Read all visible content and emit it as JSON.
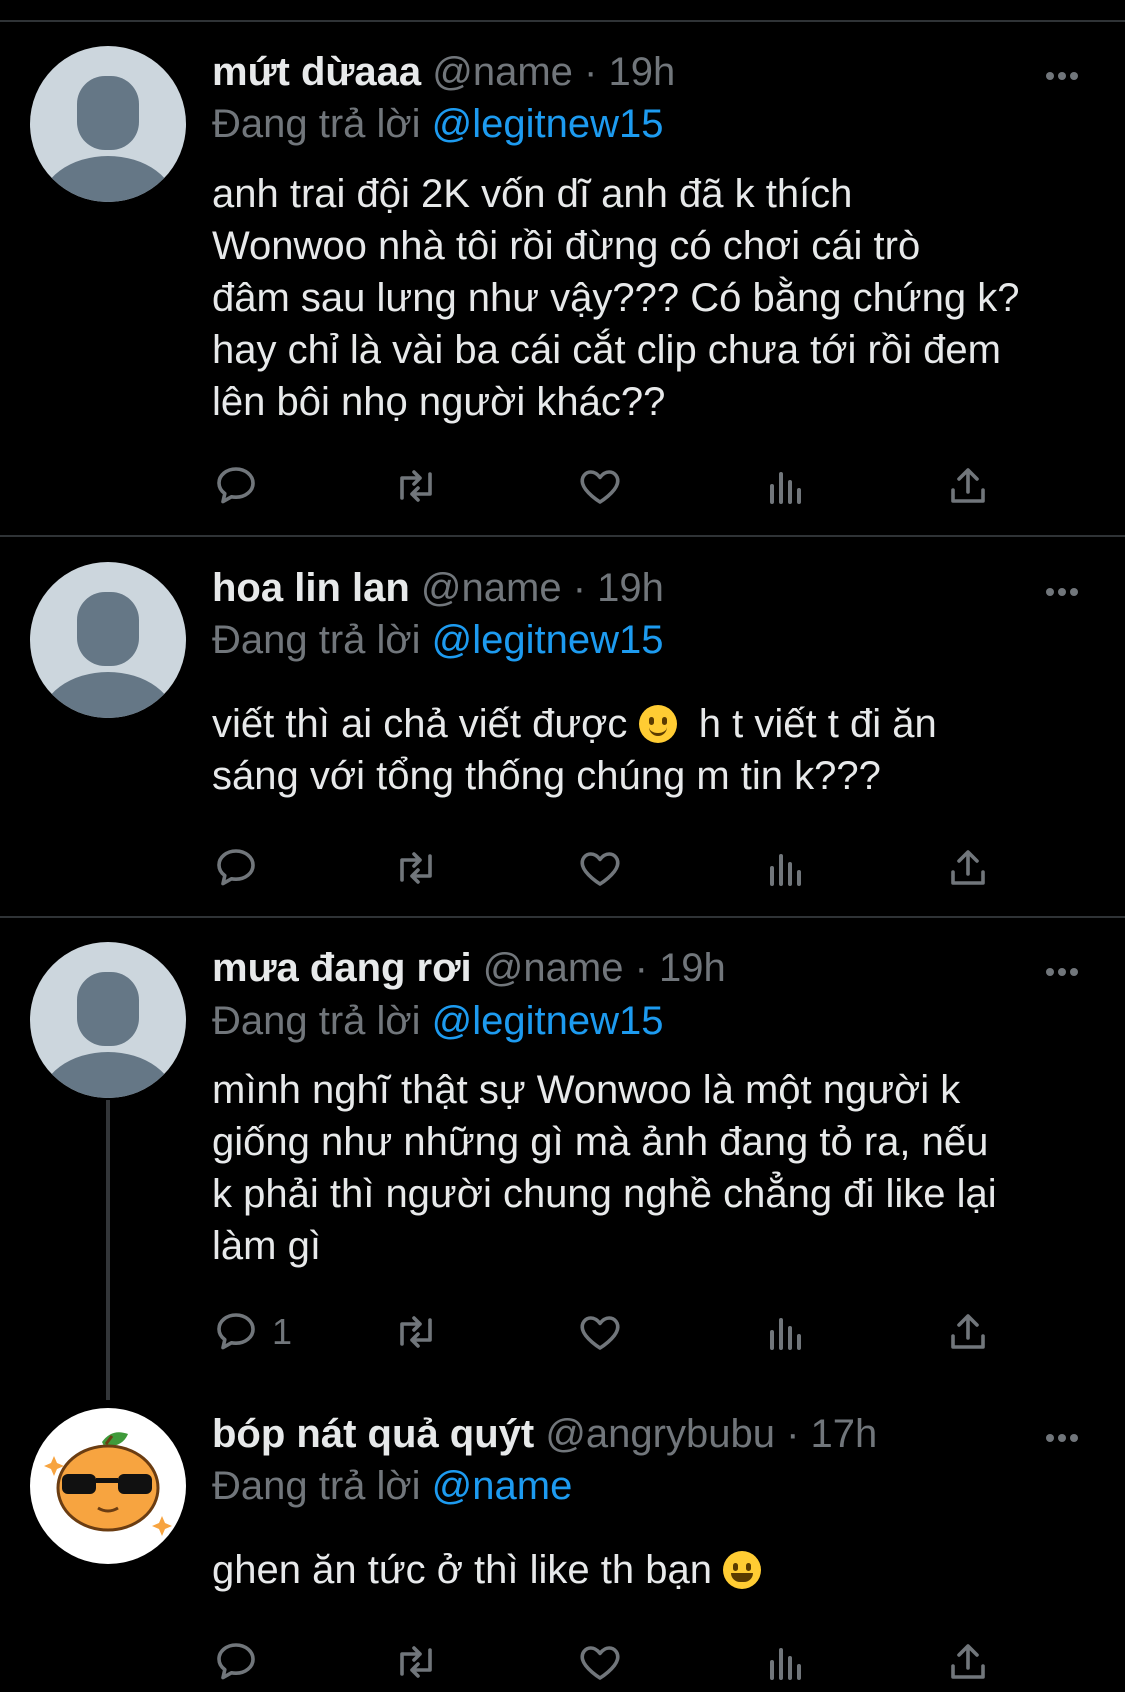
{
  "tweets": [
    {
      "name": "mứt dừaaa",
      "handle": "@name",
      "dot": "·",
      "time": "19h",
      "reply_prefix": "Đang trả lời",
      "reply_to": "@legitnew15",
      "lines": [
        "anh trai đội 2K vốn dĩ anh đã k thích",
        "Wonwoo nhà tôi rồi đừng có chơi cái trò",
        "đâm sau lưng như vậy??? Có bằng chứng k?",
        "hay chỉ là vài ba cái cắt clip chưa tới rồi đem",
        "lên bôi nhọ người khác??"
      ],
      "reply_count": ""
    },
    {
      "name": "hoa lin lan",
      "handle": "@name",
      "dot": "·",
      "time": "19h",
      "reply_prefix": "Đang trả lời",
      "reply_to": "@legitnew15",
      "line1_a": "viết thì ai chả viết được",
      "line1_b": "h t viết t đi ăn",
      "line2": "sáng với tổng thống chúng m tin k???",
      "reply_count": ""
    },
    {
      "name": "mưa đang rơi",
      "handle": "@name",
      "dot": "·",
      "time": "19h",
      "reply_prefix": "Đang trả lời",
      "reply_to": "@legitnew15",
      "lines": [
        "mình nghĩ thật sự Wonwoo là một người k",
        "giống như những gì mà ảnh đang tỏ ra, nếu",
        "k phải thì người chung nghề chẳng đi like lại",
        "làm gì"
      ],
      "reply_count": "1"
    },
    {
      "name": "bóp nát quả quýt",
      "handle": "@angrybubu",
      "dot": "·",
      "time": "17h",
      "reply_prefix": "Đang trả lời",
      "reply_to": "@name",
      "line1": "ghen ăn tức ở thì like th bạn",
      "reply_count": ""
    }
  ],
  "colors": {
    "background": "#000000",
    "text": "#e7e9ea",
    "muted": "#71767b",
    "link": "#1d9bf0",
    "separator": "#2f3336"
  },
  "icons": [
    "reply-icon",
    "retweet-icon",
    "like-icon",
    "views-icon",
    "share-icon",
    "more-icon"
  ]
}
